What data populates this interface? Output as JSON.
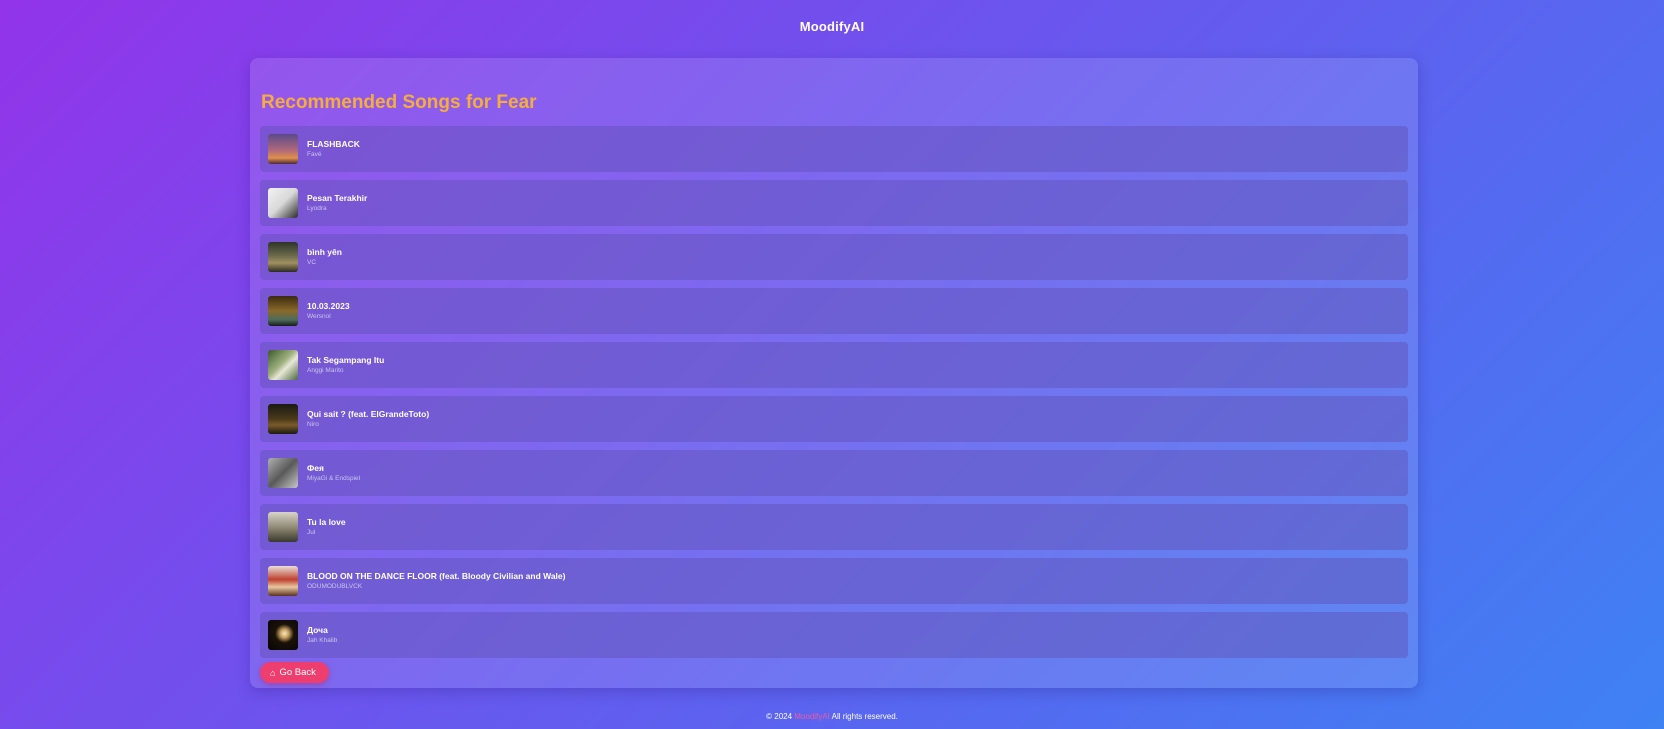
{
  "header": {
    "brand": "MoodifyAI"
  },
  "page": {
    "title": "Recommended Songs for Fear"
  },
  "songs": [
    {
      "title": "FLASHBACK",
      "artist": "Favé"
    },
    {
      "title": "Pesan Terakhir",
      "artist": "Lyodra"
    },
    {
      "title": "bình yên",
      "artist": "VC"
    },
    {
      "title": "10.03.2023",
      "artist": "Wersnol"
    },
    {
      "title": "Tak Segampang Itu",
      "artist": "Anggi Marito"
    },
    {
      "title": "Qui sait ? (feat. ElGrandeToto)",
      "artist": "Niro"
    },
    {
      "title": "Фея",
      "artist": "MiyaGi & Endspiel"
    },
    {
      "title": "Tu la love",
      "artist": "Jul"
    },
    {
      "title": "BLOOD ON THE DANCE FLOOR (feat. Bloody Civilian and Wale)",
      "artist": "ODUMODUBLVCK"
    },
    {
      "title": "Доча",
      "artist": "Jah Khalib"
    }
  ],
  "actions": {
    "go_back_label": "Go Back",
    "go_back_icon": "home-icon"
  },
  "footer": {
    "prefix": "© 2024 ",
    "brand": "MoodifyAI",
    "suffix": " All rights reserved."
  },
  "colors": {
    "title": "#f6ad3c",
    "button": "#ee3e6f",
    "footer_brand": "#f05aa0"
  }
}
